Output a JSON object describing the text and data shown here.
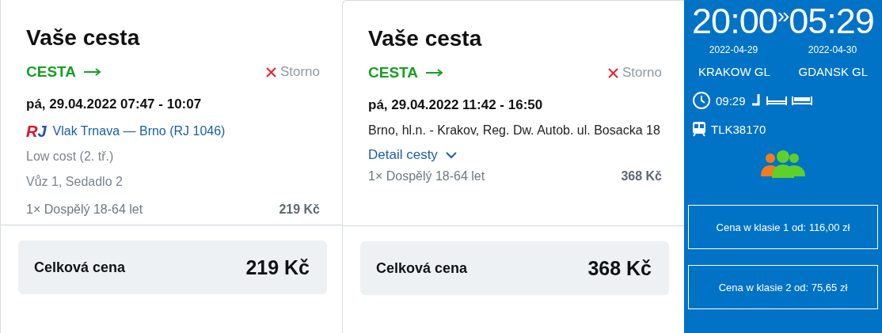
{
  "cards": [
    {
      "title": "Vaše cesta",
      "direction": "CESTA",
      "cancel": "Storno",
      "datetime": "pá, 29.04.2022 07:47 - 10:07",
      "lines": [
        {
          "kind": "train",
          "logo": "RJ",
          "text": "Vlak Trnava — Brno (RJ 1046)"
        },
        {
          "kind": "muted",
          "text": "Low cost (2. tř.)"
        },
        {
          "kind": "muted",
          "text": "Vůz 1, Sedadlo 2"
        }
      ],
      "passenger": "1× Dospělý 18-64 let",
      "passenger_price": "219 Kč",
      "total_label": "Celková cena",
      "total": "219 Kč"
    },
    {
      "title": "Vaše cesta",
      "direction": "CESTA",
      "cancel": "Storno",
      "datetime": "pá, 29.04.2022 11:42 - 16:50",
      "lines": [
        {
          "kind": "plain",
          "text": "Brno, hl.n. - Krakov, Reg. Dw. Autob. ul. Bosacka 18"
        },
        {
          "kind": "toggle",
          "text": "Detail cesty",
          "expanded": false
        }
      ],
      "passenger": "1× Dospělý 18-64 let",
      "passenger_price": "368 Kč",
      "total_label": "Celková cena",
      "total": "368 Kč"
    }
  ],
  "connection": {
    "departure": "20:00",
    "separator": "»",
    "arrival": "05:29",
    "departure_date": "2022-04-29",
    "arrival_date": "2022-04-30",
    "from": "KRAKOW GL",
    "to": "GDANSK GL",
    "duration": "09:29",
    "train": "TLK38170",
    "prices": [
      "Cena w klasie 1 od: 116,00 zł",
      "Cena w klasie 2 od: 75,65 zł"
    ]
  }
}
